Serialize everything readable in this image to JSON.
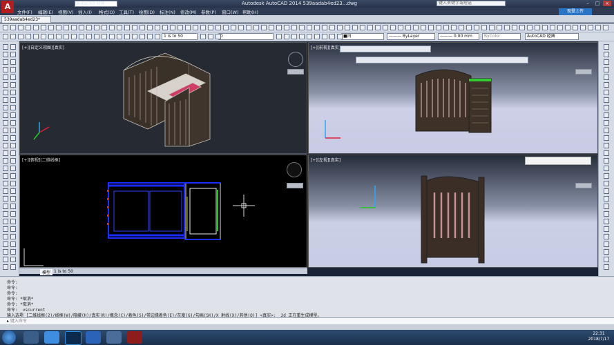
{
  "title_bar": {
    "title": "Autodesk AutoCAD 2014    539aadab4ed23...dwg",
    "search_placeholder": "键入关键字或短语",
    "workspace": "AutoCAD 经典",
    "login_label": "现登上传"
  },
  "menu": [
    "文件(F)",
    "编辑(E)",
    "视图(V)",
    "插入(I)",
    "格式(O)",
    "工具(T)",
    "绘图(D)",
    "标注(N)",
    "修改(M)",
    "参数(P)",
    "窗口(W)",
    "帮助(H)"
  ],
  "doc_tab": "539aadab4ed23*",
  "toolbar2": {
    "scale": "1 is to 50",
    "layer": "0",
    "color": "■白",
    "linetype": "——— ByLayer",
    "lineweight": "——— 0.00 mm",
    "plotstyle": "ByColor",
    "workspace2": "AutoCAD 经典"
  },
  "viewports": {
    "top_left": "[+][自定义视图][真实]",
    "top_right": "[+][前视][真实]",
    "bottom_left": "[+][俯视][二维线框]",
    "bottom_right": "[+][左视][真实]"
  },
  "layout_tabs": {
    "model": "模型",
    "scale": "1 is to 50"
  },
  "command_history": [
    "命令:",
    "命令:",
    "命令:",
    "命令: *取消*",
    "命令: *取消*",
    "命令: _vscurrent",
    "输入选项 [二维线框(2)/线框(W)/隐藏(H)/真实(R)/概念(C)/着色(S)/带边缘着色(E)/灰度(G)/勾画(SK)/X 射线(X)/其他(O)] <真实>: _2d 正在重生成模型。"
  ],
  "command_input": "键入命令",
  "clock": {
    "time": "22:31",
    "date": "2018/7/17"
  },
  "colors": {
    "accent": "#2a74c6",
    "titlebar": "#26324a",
    "autocad_red": "#b31d1d"
  }
}
